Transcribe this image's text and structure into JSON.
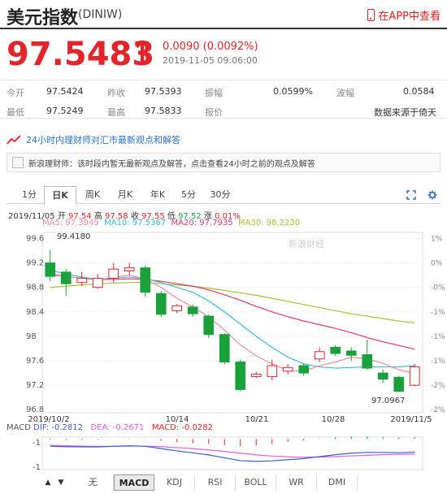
{
  "header": {
    "title": "美元指数",
    "code": "(DINIW)",
    "app_link": "在APP中查看"
  },
  "quote": {
    "price": "97.5483",
    "arrow": "↑",
    "change": "0.0090 (0.0092%)",
    "timestamp": "2019-11-05 09:06:00"
  },
  "stats": [
    {
      "label": "今开",
      "value": "97.5424"
    },
    {
      "label": "昨收",
      "value": "97.5393"
    },
    {
      "label": "振幅",
      "value": "0.0599%"
    },
    {
      "label": "波幅",
      "value": "0.0584"
    },
    {
      "label": "最低",
      "value": "97.5249"
    },
    {
      "label": "最高",
      "value": "97.5833"
    },
    {
      "label": "报价",
      "value": ""
    },
    {
      "label": "",
      "value": "数据来源于倚天"
    }
  ],
  "expert": {
    "title": "24小时内理财师对汇市最新观点和解答",
    "message": "新浪理财师：该时段内暂无最新观点及解答，点击查看24小时之前的观点及解答"
  },
  "tabs": [
    "1分",
    "日K",
    "周K",
    "月K",
    "年K",
    "5分",
    "30分"
  ],
  "active_tab": "日K",
  "chart_info": {
    "date": "2019/11/05",
    "open_label": "开",
    "open": "97.54",
    "high_label": "高",
    "high": "97.58",
    "close_label": "收",
    "close": "97.55",
    "low_label": "低",
    "low": "97.52",
    "pct_label": "涨",
    "pct": "0.01%",
    "ma5": "MA5: 97.3949",
    "ma10": "MA10: 97.5367",
    "ma20": "MA20: 97.7935",
    "ma30": "MA30: 98.2230",
    "watermark": "新浪财经"
  },
  "colors": {
    "up": "#e3242b",
    "down": "#1aa13b",
    "ma5": "#f08aa0",
    "ma10": "#3bb8d8",
    "ma20": "#e0386a",
    "ma30": "#a8c232",
    "dif": "#3a5fd0",
    "dea": "#e060e0"
  },
  "chart_data": {
    "type": "candlestick",
    "y_ticks": [
      "99.6",
      "99.2",
      "98.8",
      "98.4",
      "98",
      "97.6",
      "97.2",
      "96.8"
    ],
    "pct_ticks": [
      "1%",
      "0%",
      "-0%",
      "-1%",
      "-1%",
      "-1%",
      "-2%",
      "-2%"
    ],
    "x_labels": [
      "2019/10/2",
      "10/14",
      "10/21",
      "10/28",
      "2019/11/5"
    ],
    "annotations": {
      "max": "99.4180",
      "min": "97.0967"
    },
    "ylim": [
      96.75,
      99.7
    ],
    "candles": [
      {
        "o": 99.2,
        "c": 98.98,
        "h": 99.41,
        "l": 98.9
      },
      {
        "o": 99.05,
        "c": 98.86,
        "h": 99.1,
        "l": 98.66
      },
      {
        "o": 98.88,
        "c": 98.95,
        "h": 99.05,
        "l": 98.82
      },
      {
        "o": 98.8,
        "c": 98.95,
        "h": 99.02,
        "l": 98.78
      },
      {
        "o": 98.95,
        "c": 99.1,
        "h": 99.2,
        "l": 98.88
      },
      {
        "o": 99.07,
        "c": 99.12,
        "h": 99.2,
        "l": 99.0
      },
      {
        "o": 99.12,
        "c": 98.72,
        "h": 99.15,
        "l": 98.65
      },
      {
        "o": 98.7,
        "c": 98.36,
        "h": 98.74,
        "l": 98.32
      },
      {
        "o": 98.42,
        "c": 98.5,
        "h": 98.53,
        "l": 98.38
      },
      {
        "o": 98.48,
        "c": 98.37,
        "h": 98.52,
        "l": 98.32
      },
      {
        "o": 98.33,
        "c": 98.03,
        "h": 98.36,
        "l": 97.97
      },
      {
        "o": 98.03,
        "c": 97.58,
        "h": 98.05,
        "l": 97.54
      },
      {
        "o": 97.58,
        "c": 97.13,
        "h": 97.62,
        "l": 97.1
      },
      {
        "o": 97.34,
        "c": 97.38,
        "h": 97.42,
        "l": 97.32
      },
      {
        "o": 97.34,
        "c": 97.52,
        "h": 97.62,
        "l": 97.28
      },
      {
        "o": 97.43,
        "c": 97.49,
        "h": 97.55,
        "l": 97.38
      },
      {
        "o": 97.52,
        "c": 97.4,
        "h": 97.56,
        "l": 97.35
      },
      {
        "o": 97.63,
        "c": 97.75,
        "h": 97.82,
        "l": 97.58
      },
      {
        "o": 97.82,
        "c": 97.72,
        "h": 97.85,
        "l": 97.68
      },
      {
        "o": 97.76,
        "c": 97.69,
        "h": 97.82,
        "l": 97.6
      },
      {
        "o": 97.7,
        "c": 97.48,
        "h": 97.95,
        "l": 97.45
      },
      {
        "o": 97.4,
        "c": 97.3,
        "h": 97.46,
        "l": 97.24
      },
      {
        "o": 97.33,
        "c": 97.1,
        "h": 97.35,
        "l": 97.09
      },
      {
        "o": 97.2,
        "c": 97.5,
        "h": 97.55,
        "l": 97.18
      }
    ],
    "ma5": [
      99.0,
      98.98,
      98.95,
      98.92,
      98.97,
      99.0,
      98.94,
      98.8,
      98.62,
      98.48,
      98.32,
      98.1,
      97.86,
      97.68,
      97.55,
      97.44,
      97.43,
      97.52,
      97.58,
      97.66,
      97.63,
      97.56,
      97.45,
      97.4
    ],
    "ma10": [
      99.08,
      99.02,
      98.97,
      98.93,
      98.95,
      98.97,
      98.94,
      98.88,
      98.8,
      98.72,
      98.58,
      98.4,
      98.2,
      98.0,
      97.82,
      97.66,
      97.55,
      97.5,
      97.48,
      97.49,
      97.5,
      97.5,
      97.5,
      97.52
    ],
    "ma20": [
      99.02,
      98.98,
      98.95,
      98.93,
      98.93,
      98.94,
      98.93,
      98.9,
      98.86,
      98.82,
      98.76,
      98.68,
      98.59,
      98.49,
      98.4,
      98.32,
      98.25,
      98.19,
      98.13,
      98.06,
      97.98,
      97.91,
      97.85,
      97.79
    ],
    "ma30": [
      98.8,
      98.82,
      98.84,
      98.86,
      98.87,
      98.88,
      98.88,
      98.86,
      98.84,
      98.82,
      98.79,
      98.75,
      98.71,
      98.67,
      98.62,
      98.57,
      98.52,
      98.47,
      98.42,
      98.37,
      98.33,
      98.29,
      98.25,
      98.22
    ]
  },
  "macd": {
    "label": "MACD",
    "dif": "DIF: -0.2812",
    "dea": "DEA: -0.2671",
    "macd": "MACD: -0.0282",
    "y_ticks": [
      "-1",
      "-1"
    ],
    "ylim": [
      -1.6,
      0.1
    ],
    "dif_values": [
      -0.38,
      -0.4,
      -0.41,
      -0.41,
      -0.38,
      -0.35,
      -0.38,
      -0.5,
      -0.62,
      -0.72,
      -0.83,
      -0.98,
      -1.13,
      -1.17,
      -1.14,
      -1.08,
      -1.02,
      -0.92,
      -0.82,
      -0.74,
      -0.7,
      -0.7,
      -0.72,
      -0.68
    ],
    "dea_values": [
      -0.33,
      -0.35,
      -0.37,
      -0.38,
      -0.38,
      -0.37,
      -0.37,
      -0.4,
      -0.45,
      -0.5,
      -0.57,
      -0.65,
      -0.74,
      -0.83,
      -0.89,
      -0.93,
      -0.95,
      -0.94,
      -0.92,
      -0.88,
      -0.85,
      -0.82,
      -0.8,
      -0.78
    ],
    "hist": [
      -0.05,
      -0.05,
      -0.04,
      -0.03,
      0.0,
      0.02,
      -0.01,
      -0.1,
      -0.17,
      -0.22,
      -0.26,
      -0.33,
      -0.39,
      -0.34,
      -0.25,
      -0.15,
      -0.07,
      0.02,
      0.1,
      0.14,
      0.15,
      0.12,
      0.08,
      0.1
    ]
  },
  "bottom_tabs": [
    "无",
    "MACD",
    "KDJ",
    "RSI",
    "BOLL",
    "WR",
    "DMI"
  ],
  "active_bottom_tab": "MACD"
}
